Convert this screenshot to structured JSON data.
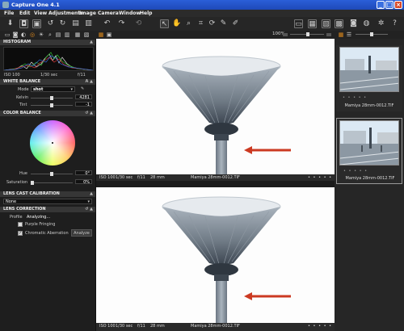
{
  "window": {
    "title": "Capture One 4.1"
  },
  "menu": [
    "File",
    "Edit",
    "View",
    "Adjustments",
    "Image",
    "Camera",
    "Window",
    "Help"
  ],
  "toolbar": {
    "zoom": "100%"
  },
  "histogram": {
    "title": "HISTOGRAM",
    "iso": "ISO 100",
    "shutter": "1/30 sec",
    "aperture": "f/11"
  },
  "white_balance": {
    "title": "WHITE BALANCE",
    "mode_label": "Mode",
    "mode_value": "shot",
    "kelvin_label": "Kelvin",
    "kelvin_value": "4281",
    "tint_label": "Tint",
    "tint_value": "-1"
  },
  "color_balance": {
    "title": "COLOR BALANCE",
    "hue_label": "Hue",
    "hue_value": "0°",
    "saturation_label": "Saturation",
    "saturation_value": "0%"
  },
  "lens_cast": {
    "title": "LENS CAST CALIBRATION",
    "value": "None"
  },
  "lens_correction": {
    "title": "LENS CORRECTION",
    "profile_label": "Profile",
    "profile_value": "Analyzing...",
    "purple_fringing": "Purple Fringing",
    "chromatic_aberration": "Chromatic Aberration",
    "analyze_button": "Analyze"
  },
  "viewer": {
    "iso": "ISO 100",
    "shutter": "1/30 sec",
    "aperture": "f/11",
    "focal": "28 mm",
    "filename": "Mamiya 28mm-0012.TIF"
  },
  "browser": {
    "thumb1_caption": "Mamiya 28mm-0012.TIF",
    "thumb2_caption": "Mamiya 28mm-0012.TIF"
  },
  "colors": {
    "titlebar": "#2b5fd8",
    "arrow": "#cc3a22",
    "accent": "#e08a1c"
  }
}
